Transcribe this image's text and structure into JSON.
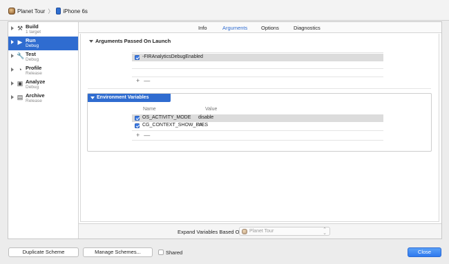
{
  "breadcrumb": {
    "scheme": "Planet Tour",
    "device": "iPhone 6s"
  },
  "sidebar": {
    "items": [
      {
        "title": "Build",
        "subtitle": "1 target",
        "icon": "hammer-icon"
      },
      {
        "title": "Run",
        "subtitle": "Debug",
        "icon": "play-icon"
      },
      {
        "title": "Test",
        "subtitle": "Debug",
        "icon": "wrench-icon"
      },
      {
        "title": "Profile",
        "subtitle": "Release",
        "icon": "gauge-icon"
      },
      {
        "title": "Analyze",
        "subtitle": "Debug",
        "icon": "analyze-icon"
      },
      {
        "title": "Archive",
        "subtitle": "Release",
        "icon": "archive-icon"
      }
    ],
    "selected": "Run"
  },
  "tabs": [
    {
      "label": "Info"
    },
    {
      "label": "Arguments",
      "active": true
    },
    {
      "label": "Options"
    },
    {
      "label": "Diagnostics"
    }
  ],
  "arguments": {
    "title": "Arguments Passed On Launch",
    "rows": [
      {
        "checked": true,
        "value": "-FIRAnalyticsDebugEnabled"
      }
    ]
  },
  "environment": {
    "title": "Environment Variables",
    "columns": {
      "name": "Name",
      "value": "Value"
    },
    "rows": [
      {
        "checked": true,
        "name": "OS_ACTIVITY_MODE",
        "value": "disable"
      },
      {
        "checked": true,
        "name": "CG_CONTEXT_SHOW_BA...",
        "value": "YES"
      }
    ]
  },
  "controls": {
    "plus": "+",
    "minus": "—"
  },
  "expand": {
    "label": "Expand Variables Based On",
    "selected": "Planet Tour"
  },
  "footer": {
    "duplicate": "Duplicate Scheme",
    "manage": "Manage Schemes...",
    "shared": "Shared",
    "close": "Close"
  },
  "colors": {
    "accent": "#2f6cd0",
    "checkbox": "#3c7be6"
  }
}
